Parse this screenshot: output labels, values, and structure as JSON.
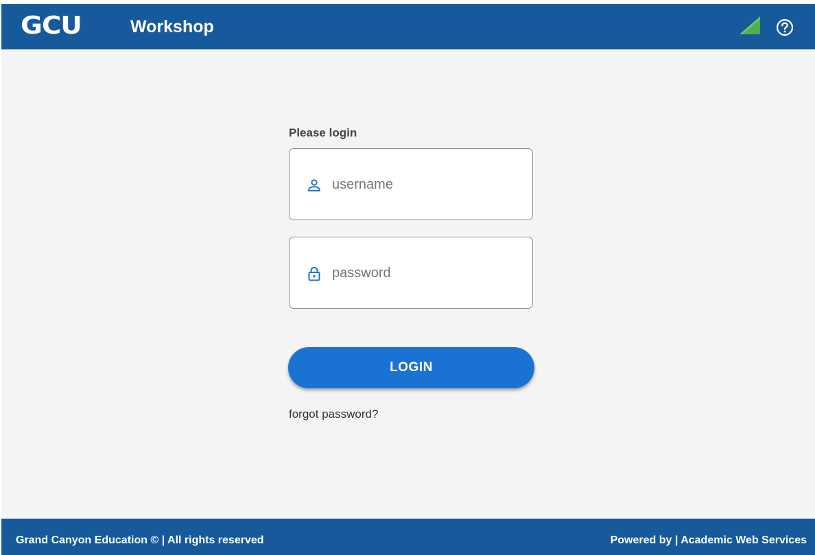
{
  "header": {
    "logo_text": "GCU",
    "app_title": "Workshop",
    "signal_icon": "signal-strength-icon",
    "help_icon": "help-circle-icon",
    "colors": {
      "bar": "#175a9c",
      "signal": "#4caf50"
    }
  },
  "login": {
    "heading": "Please login",
    "username": {
      "icon": "user-icon",
      "placeholder": "username",
      "value": ""
    },
    "password": {
      "icon": "lock-icon",
      "placeholder": "password",
      "value": ""
    },
    "button_label": "LOGIN",
    "button_color": "#1a73d3",
    "forgot_link": "forgot password?"
  },
  "footer": {
    "left_text": "Grand Canyon Education © | All rights reserved",
    "right_text": "Powered by | Academic Web Services"
  }
}
